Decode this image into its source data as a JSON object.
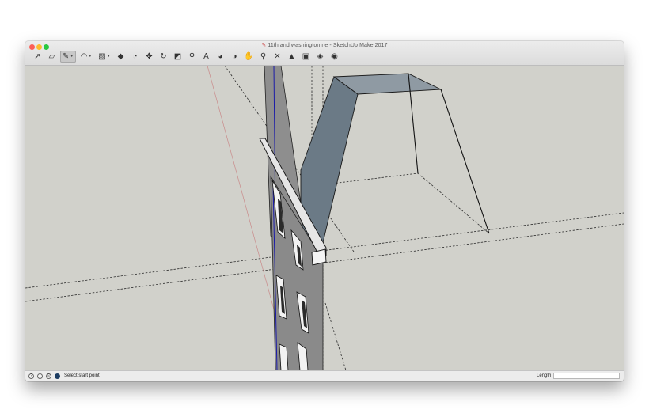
{
  "window": {
    "title": "11th and washington ne - SketchUp Make 2017",
    "doc_icon": "sketchup-document-icon"
  },
  "toolbar": {
    "tools": [
      {
        "name": "select-tool",
        "glyph": "➚",
        "label": "Select"
      },
      {
        "name": "eraser-tool",
        "glyph": "▱",
        "label": "Eraser"
      },
      {
        "name": "line-tool",
        "glyph": "✎",
        "label": "Line",
        "active": true,
        "dropdown": true
      },
      {
        "name": "arc-tool",
        "glyph": "◠",
        "label": "Arc",
        "dropdown": true
      },
      {
        "name": "rectangle-tool",
        "glyph": "▨",
        "label": "Rectangle",
        "dropdown": true
      },
      {
        "name": "push-pull-tool",
        "glyph": "◆",
        "label": "Push/Pull"
      },
      {
        "name": "offset-tool",
        "glyph": "◔",
        "label": "Offset"
      },
      {
        "name": "move-tool",
        "glyph": "✥",
        "label": "Move"
      },
      {
        "name": "rotate-tool",
        "glyph": "↻",
        "label": "Rotate"
      },
      {
        "name": "scale-tool",
        "glyph": "◩",
        "label": "Scale"
      },
      {
        "name": "tape-measure-tool",
        "glyph": "⚲",
        "label": "Tape Measure"
      },
      {
        "name": "text-tool",
        "glyph": "A",
        "label": "Text"
      },
      {
        "name": "paint-bucket-tool",
        "glyph": "◕",
        "label": "Paint Bucket"
      },
      {
        "name": "orbit-tool",
        "glyph": "◑",
        "label": "Orbit"
      },
      {
        "name": "pan-tool",
        "glyph": "✋",
        "label": "Pan"
      },
      {
        "name": "zoom-tool",
        "glyph": "⚲",
        "label": "Zoom"
      },
      {
        "name": "zoom-extents-tool",
        "glyph": "✕",
        "label": "Zoom Extents"
      },
      {
        "name": "warehouse-tool",
        "glyph": "▲",
        "label": "3D Warehouse"
      },
      {
        "name": "extension-warehouse-tool",
        "glyph": "▣",
        "label": "Extension Warehouse"
      },
      {
        "name": "layout-tool",
        "glyph": "◈",
        "label": "Send to LayOut"
      },
      {
        "name": "extension-manager-tool",
        "glyph": "◉",
        "label": "Extension Manager"
      }
    ]
  },
  "statusbar": {
    "icons": [
      "info-icon",
      "geolocation-icon",
      "credits-icon",
      "user-icon"
    ],
    "message": "Select start point",
    "length_label": "Length",
    "length_value": ""
  },
  "colors": {
    "viewport_bg": "#d1d1cb",
    "titlebar_bg": "#e6e6e6",
    "shaded_face": "#6b7a86",
    "facade": "#8e8e8e",
    "axis_red": "#c98a8a"
  }
}
